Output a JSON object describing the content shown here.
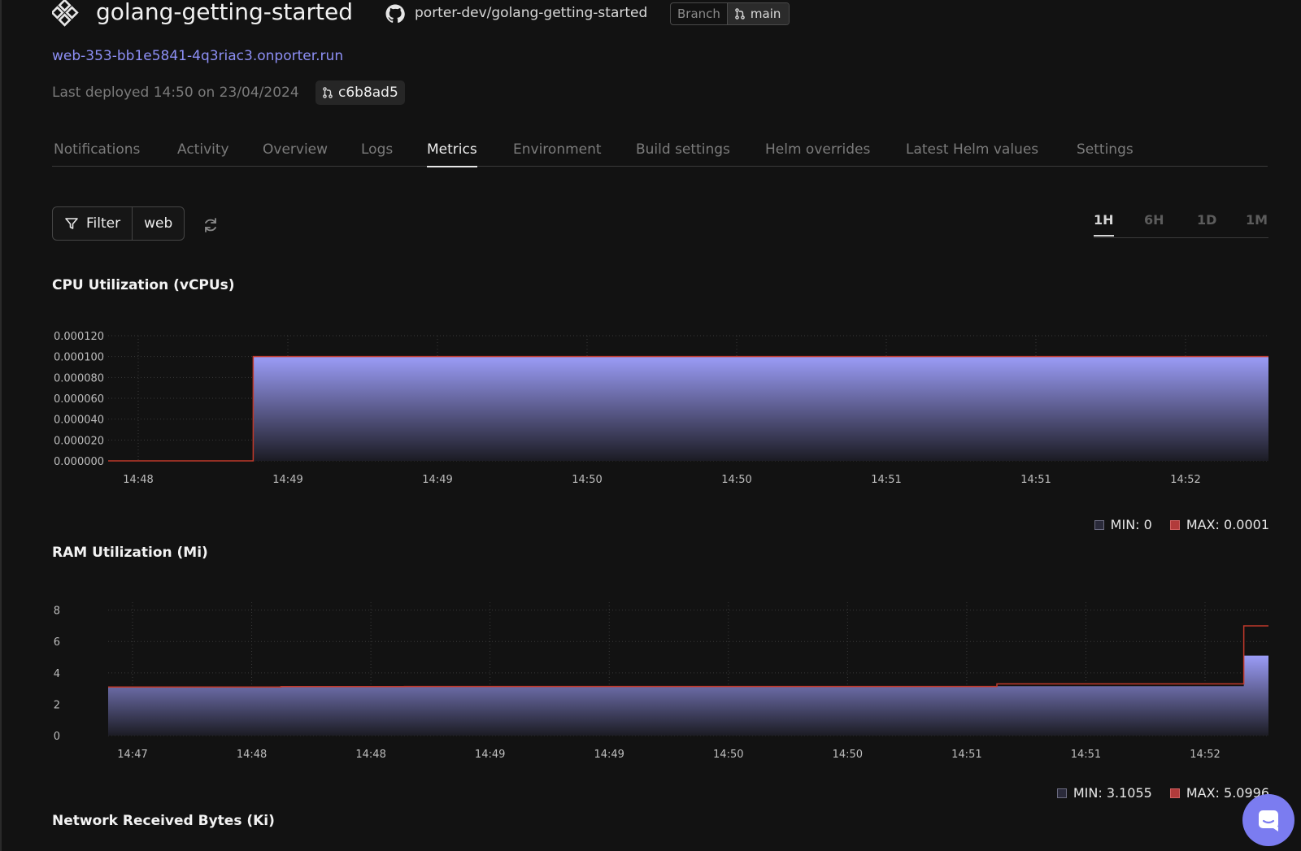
{
  "header": {
    "app_icon": "porter-logo-icon",
    "title": "golang-getting-started",
    "repo_icon": "github-icon",
    "repo": "porter-dev/golang-getting-started",
    "branch_label": "Branch",
    "branch_icon": "git-branch-icon",
    "branch_value": "main"
  },
  "url": "web-353-bb1e5841-4q3riac3.onporter.run",
  "deployed_text": "Last deployed 14:50 on 23/04/2024",
  "commit": {
    "icon": "git-commit-icon",
    "hash": "c6b8ad5"
  },
  "tabs": [
    {
      "label": "Notifications"
    },
    {
      "label": "Activity"
    },
    {
      "label": "Overview"
    },
    {
      "label": "Logs"
    },
    {
      "label": "Metrics",
      "active": true
    },
    {
      "label": "Environment"
    },
    {
      "label": "Build settings"
    },
    {
      "label": "Helm overrides"
    },
    {
      "label": "Latest Helm values"
    },
    {
      "label": "Settings"
    }
  ],
  "toolbar": {
    "filter_icon": "funnel-icon",
    "filter_label": "Filter",
    "filter_value": "web",
    "refresh_icon": "refresh-icon",
    "ranges": [
      {
        "label": "1H",
        "active": true
      },
      {
        "label": "6H"
      },
      {
        "label": "1D"
      },
      {
        "label": "1M"
      }
    ]
  },
  "colors": {
    "accent": "#8d8ff5",
    "area_top": "#9b9cf7",
    "area_bottom": "#1c1c24",
    "max_line": "#c0392b"
  },
  "chart_data": [
    {
      "type": "area",
      "title": "CPU Utilization (vCPUs)",
      "x_tick_labels": [
        "14:48",
        "14:49",
        "14:49",
        "14:50",
        "14:50",
        "14:51",
        "14:51",
        "14:52"
      ],
      "y_tick_labels": [
        "0.000000",
        "0.000020",
        "0.000040",
        "0.000060",
        "0.000080",
        "0.000100",
        "0.000120"
      ],
      "ylim": [
        0,
        0.00012
      ],
      "grid": true,
      "series": [
        {
          "name": "MIN",
          "values": [
            0,
            0,
            0,
            0.0001,
            0.0001,
            0.0001,
            0.0001,
            0.0001,
            0.0001,
            0.0001,
            0.0001,
            0.0001,
            0.0001,
            0.0001,
            0.0001,
            0.0001,
            0.0001,
            0.0001,
            0.0001,
            0.0001,
            0.0001,
            0.0001,
            0.0001,
            0.0001,
            0.0001
          ]
        },
        {
          "name": "MAX",
          "values": [
            0,
            0,
            0,
            0.0001,
            0.0001,
            0.0001,
            0.0001,
            0.0001,
            0.0001,
            0.0001,
            0.0001,
            0.0001,
            0.0001,
            0.0001,
            0.0001,
            0.0001,
            0.0001,
            0.0001,
            0.0001,
            0.0001,
            0.0001,
            0.0001,
            0.0001,
            0.0001,
            0.0001
          ]
        }
      ],
      "legend": [
        {
          "label": "MIN: 0",
          "kind": "min"
        },
        {
          "label": "MAX: 0.0001",
          "kind": "max"
        }
      ]
    },
    {
      "type": "area",
      "title": "RAM Utilization (Mi)",
      "x_tick_labels": [
        "14:47",
        "14:48",
        "14:48",
        "14:49",
        "14:49",
        "14:50",
        "14:50",
        "14:51",
        "14:51",
        "14:52"
      ],
      "y_tick_labels": [
        "0",
        "2",
        "4",
        "6",
        "8"
      ],
      "ylim": [
        0,
        8.5
      ],
      "grid": true,
      "series": [
        {
          "name": "MIN",
          "values": [
            3.1,
            3.1,
            3.1,
            3.1,
            3.1,
            3.1,
            3.1,
            3.12,
            3.12,
            3.12,
            3.12,
            3.12,
            3.13,
            3.13,
            3.13,
            3.13,
            3.13,
            3.13,
            3.13,
            3.13,
            3.13,
            3.13,
            3.13,
            3.13,
            3.13,
            3.13,
            3.13,
            3.13,
            3.13,
            3.13,
            3.13,
            3.13,
            3.13,
            3.13,
            3.13,
            3.13,
            3.15,
            3.15,
            3.15,
            3.15,
            3.15,
            3.15,
            3.15,
            3.15,
            3.15,
            3.15,
            5.1,
            5.1
          ]
        },
        {
          "name": "MAX",
          "values": [
            3.1,
            3.1,
            3.1,
            3.1,
            3.1,
            3.1,
            3.1,
            3.12,
            3.12,
            3.12,
            3.12,
            3.12,
            3.13,
            3.13,
            3.13,
            3.13,
            3.13,
            3.13,
            3.13,
            3.13,
            3.13,
            3.13,
            3.13,
            3.13,
            3.13,
            3.13,
            3.13,
            3.13,
            3.13,
            3.13,
            3.13,
            3.13,
            3.13,
            3.13,
            3.13,
            3.13,
            3.3,
            3.3,
            3.3,
            3.3,
            3.3,
            3.3,
            3.3,
            3.3,
            3.3,
            3.3,
            7.0,
            7.0
          ]
        }
      ],
      "legend": [
        {
          "label": "MIN: 3.1055",
          "kind": "min"
        },
        {
          "label": "MAX: 5.0996",
          "kind": "max"
        }
      ]
    },
    {
      "type": "area",
      "title": "Network Received Bytes (Ki)"
    }
  ],
  "chat_icon": "chat-bubble-icon"
}
